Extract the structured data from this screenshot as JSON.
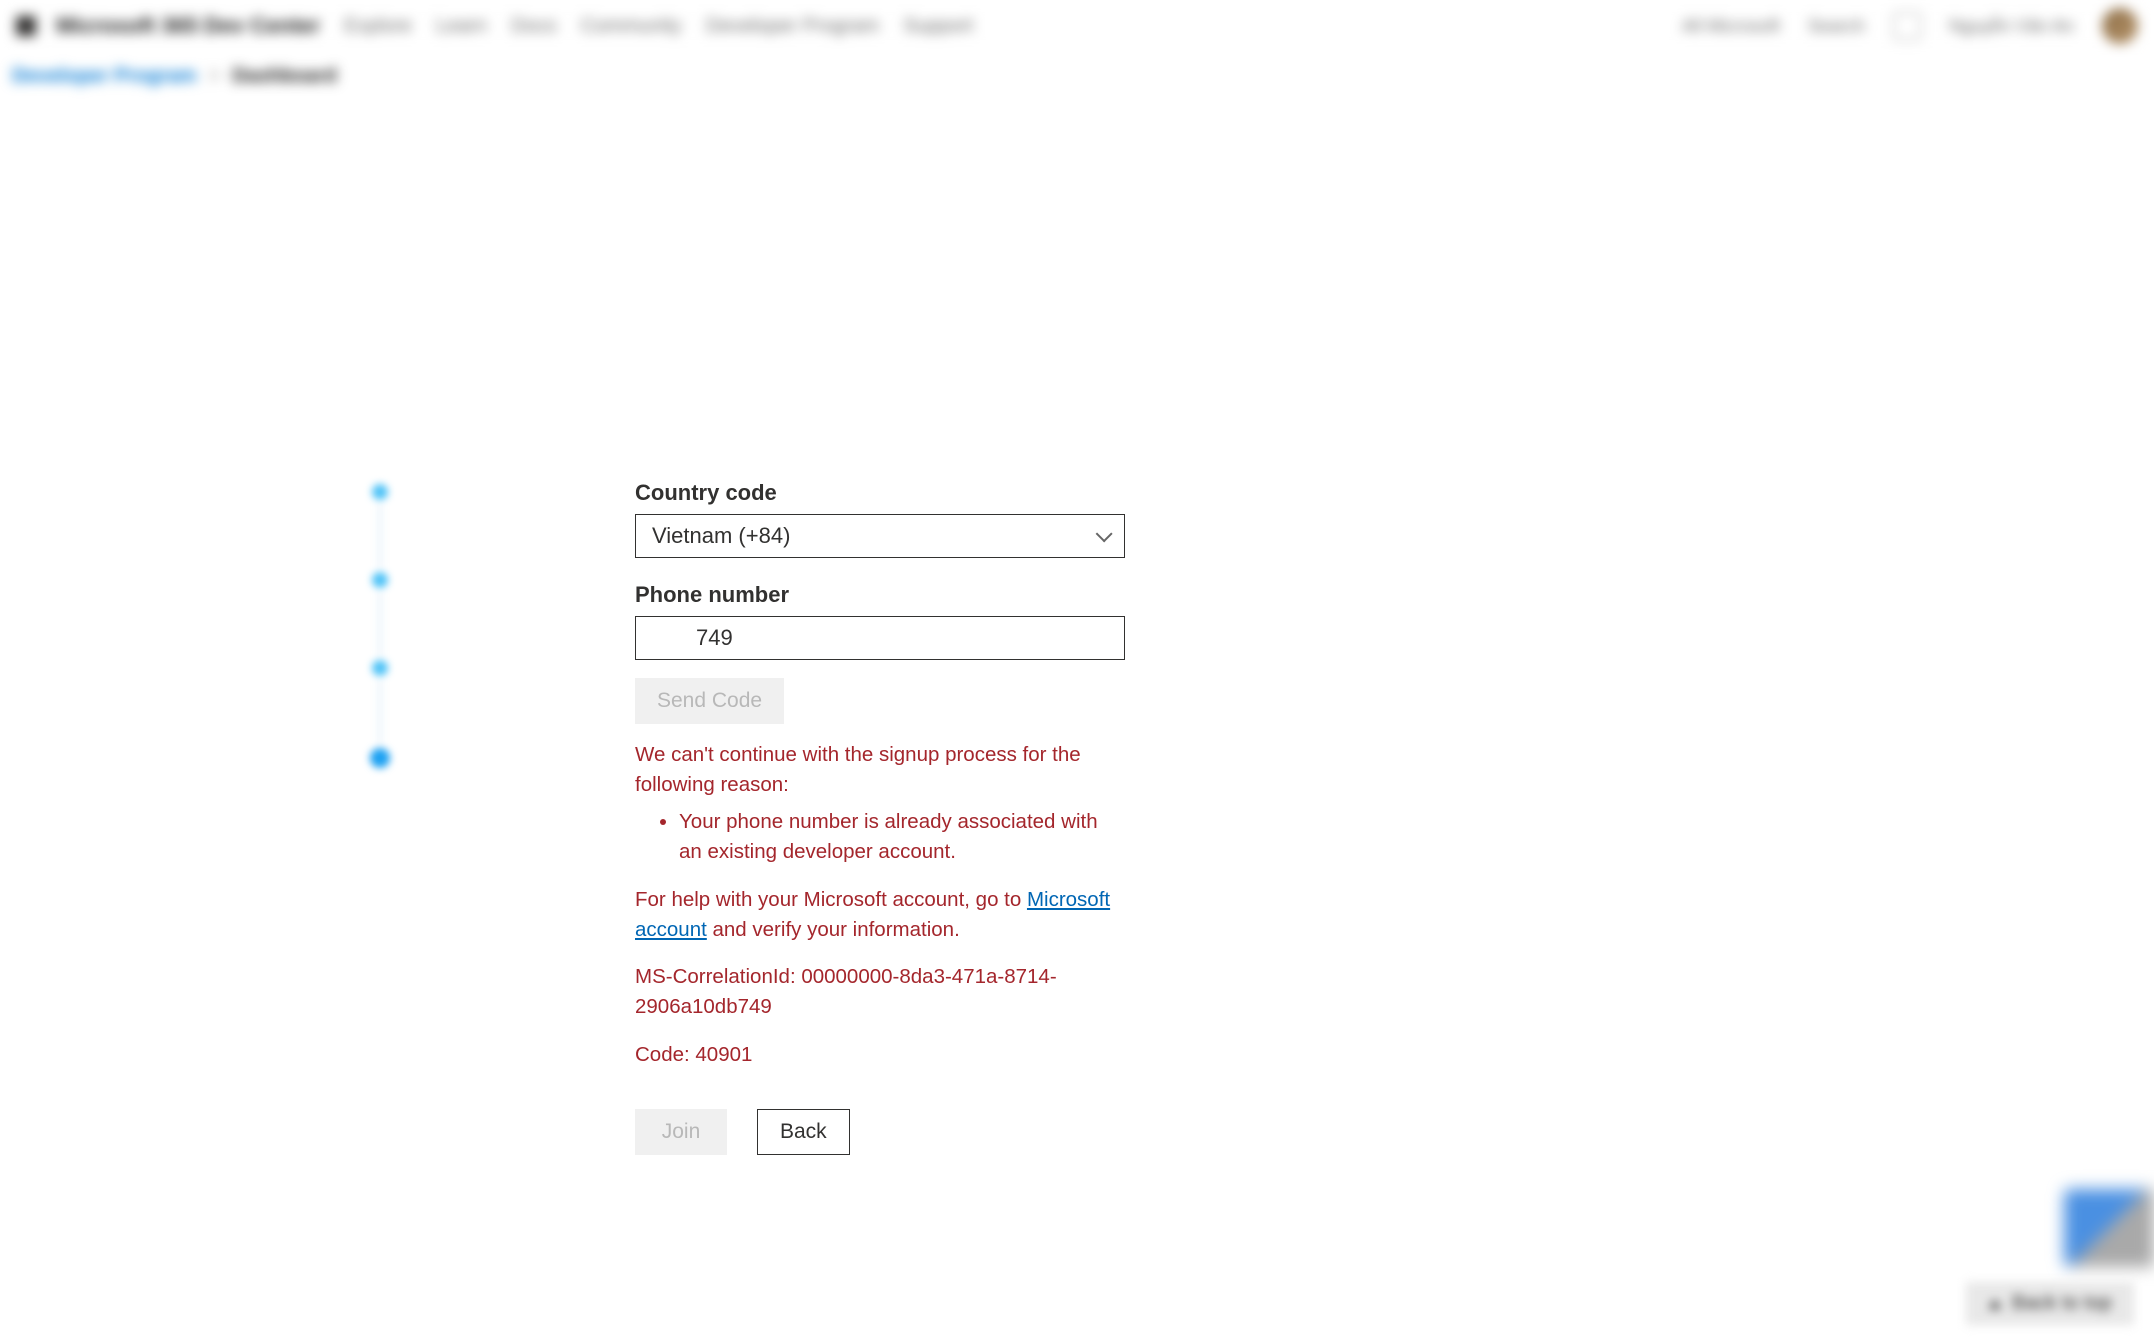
{
  "header": {
    "brand": "Microsoft 365 Dev Center",
    "nav": {
      "explore": "Explore",
      "learn": "Learn",
      "docs": "Docs",
      "community": "Community",
      "developer_program": "Developer Program",
      "support": "Support"
    },
    "right": {
      "all_microsoft": "All Microsoft",
      "search": "Search",
      "username": "Nguyễn Văn An"
    }
  },
  "breadcrumb": {
    "link": "Developer Program",
    "current": "Dashboard"
  },
  "form": {
    "country_label": "Country code",
    "country_value": "Vietnam (+84)",
    "phone_label": "Phone number",
    "phone_value": "749",
    "send_code": "Send Code"
  },
  "error": {
    "intro": "We can't continue with the signup process for the following reason:",
    "reason": "Your phone number is already associated with an existing developer account.",
    "help_prefix": "For help with your Microsoft account, go to ",
    "help_link": "Microsoft account",
    "help_suffix": " and verify your information.",
    "correlation": "MS-CorrelationId: 00000000-8da3-471a-8714-2906a10db749",
    "code": "Code: 40901"
  },
  "actions": {
    "join": "Join",
    "back": "Back"
  },
  "footer": {
    "back_to_top": "Back to top"
  }
}
